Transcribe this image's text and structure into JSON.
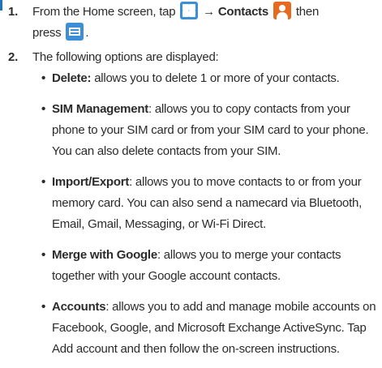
{
  "step1": {
    "number": "1.",
    "intro": "From the Home screen, tap",
    "arrow": "→",
    "contacts_label": "Contacts",
    "then": "then",
    "press": "press",
    "period": "."
  },
  "step2": {
    "number": "2.",
    "text": "The following options are displayed:"
  },
  "options": [
    {
      "term": "Delete:",
      "desc": " allows you to delete 1 or more of your contacts."
    },
    {
      "term": "SIM Management",
      "desc": ": allows you to copy contacts from your phone to your SIM card or from your SIM card to your phone. You can also delete contacts from your SIM."
    },
    {
      "term": "Import/Export",
      "desc": ": allows you to move contacts to or from your memory card. You can also send a namecard via Bluetooth, Email, Gmail, Messaging, or Wi-Fi Direct."
    },
    {
      "term": "Merge with Google",
      "desc": ": allows you to merge your contacts together with your Google account contacts."
    },
    {
      "term": "Accounts",
      "desc": ": allows you to add and manage mobile accounts on Facebook, Google, and Microsoft Exchange ActiveSync. Tap Add account and then follow the on-screen instructions."
    }
  ],
  "bullet_char": "•",
  "icons": {
    "apps": "apps-grid-icon",
    "contacts": "contacts-person-icon",
    "menu": "menu-key-icon"
  },
  "colors": {
    "accent_blue": "#3a8fd6",
    "contacts_orange": "#e66b1f",
    "text": "#2b2b2b"
  }
}
